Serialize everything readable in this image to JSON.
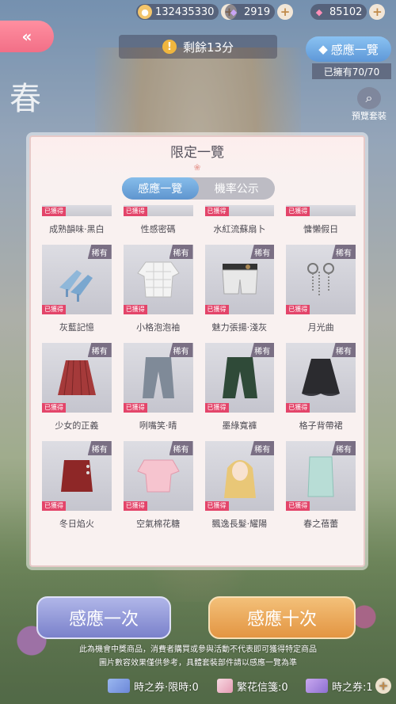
{
  "currencies": [
    {
      "icon": "cat-coin-icon",
      "value": "132435330"
    },
    {
      "icon": "diamond-icon",
      "value": "2919"
    },
    {
      "icon": "pink-diamond-icon",
      "value": "85102"
    }
  ],
  "timer": {
    "text": "剩餘13分"
  },
  "induct_button": {
    "label": "感應一覽"
  },
  "owned": {
    "text": "已擁有70/70"
  },
  "preview": {
    "label": "預覽套裝"
  },
  "banner_title": "春",
  "modal": {
    "title": "限定一覽",
    "tabs": [
      {
        "label": "感應一覽"
      },
      {
        "label": "機率公示"
      }
    ],
    "tag_obtained": "已獲得",
    "tag_rare": "稀有",
    "top_names": [
      "成熟韻味·黑白",
      "性感密碼",
      "水紅流蘇扇卜",
      "慵懶假日"
    ],
    "rows": [
      {
        "names": [
          "灰藍記憶",
          "小格泡泡袖",
          "魅力張揚·淺灰",
          "月光曲"
        ],
        "items": [
          {
            "icon": "high-heels-icon"
          },
          {
            "icon": "plaid-blouse-icon"
          },
          {
            "icon": "shorts-icon"
          },
          {
            "icon": "chain-accessory-icon"
          }
        ]
      },
      {
        "names": [
          "少女的正義",
          "咧嘴笑·晴",
          "墨綠寬褲",
          "格子背帶裙"
        ],
        "items": [
          {
            "icon": "pleated-skirt-icon"
          },
          {
            "icon": "jeans-icon"
          },
          {
            "icon": "green-pants-icon"
          },
          {
            "icon": "black-skirt-icon"
          }
        ]
      },
      {
        "names": [
          "冬日焰火",
          "空氣棉花糖",
          "飄逸長髮·耀陽",
          "春之蓓蕾"
        ],
        "items": [
          {
            "icon": "red-skirt-icon"
          },
          {
            "icon": "pink-top-icon"
          },
          {
            "icon": "long-hair-icon"
          },
          {
            "icon": "mint-skirt-icon"
          }
        ]
      }
    ]
  },
  "buttons": {
    "once": "感應一次",
    "ten": "感應十次"
  },
  "disclaimer": {
    "line1": "此為機會中獎商品，消費者購買或參與活動不代表即可獲得特定商品",
    "line2": "圖片數容效果僅供參考，具體套裝部件請以感應一覽為準"
  },
  "tickets": [
    {
      "label": "時之券·限時:0"
    },
    {
      "label": "繁花信箋:0"
    },
    {
      "label": "時之券:1"
    }
  ]
}
